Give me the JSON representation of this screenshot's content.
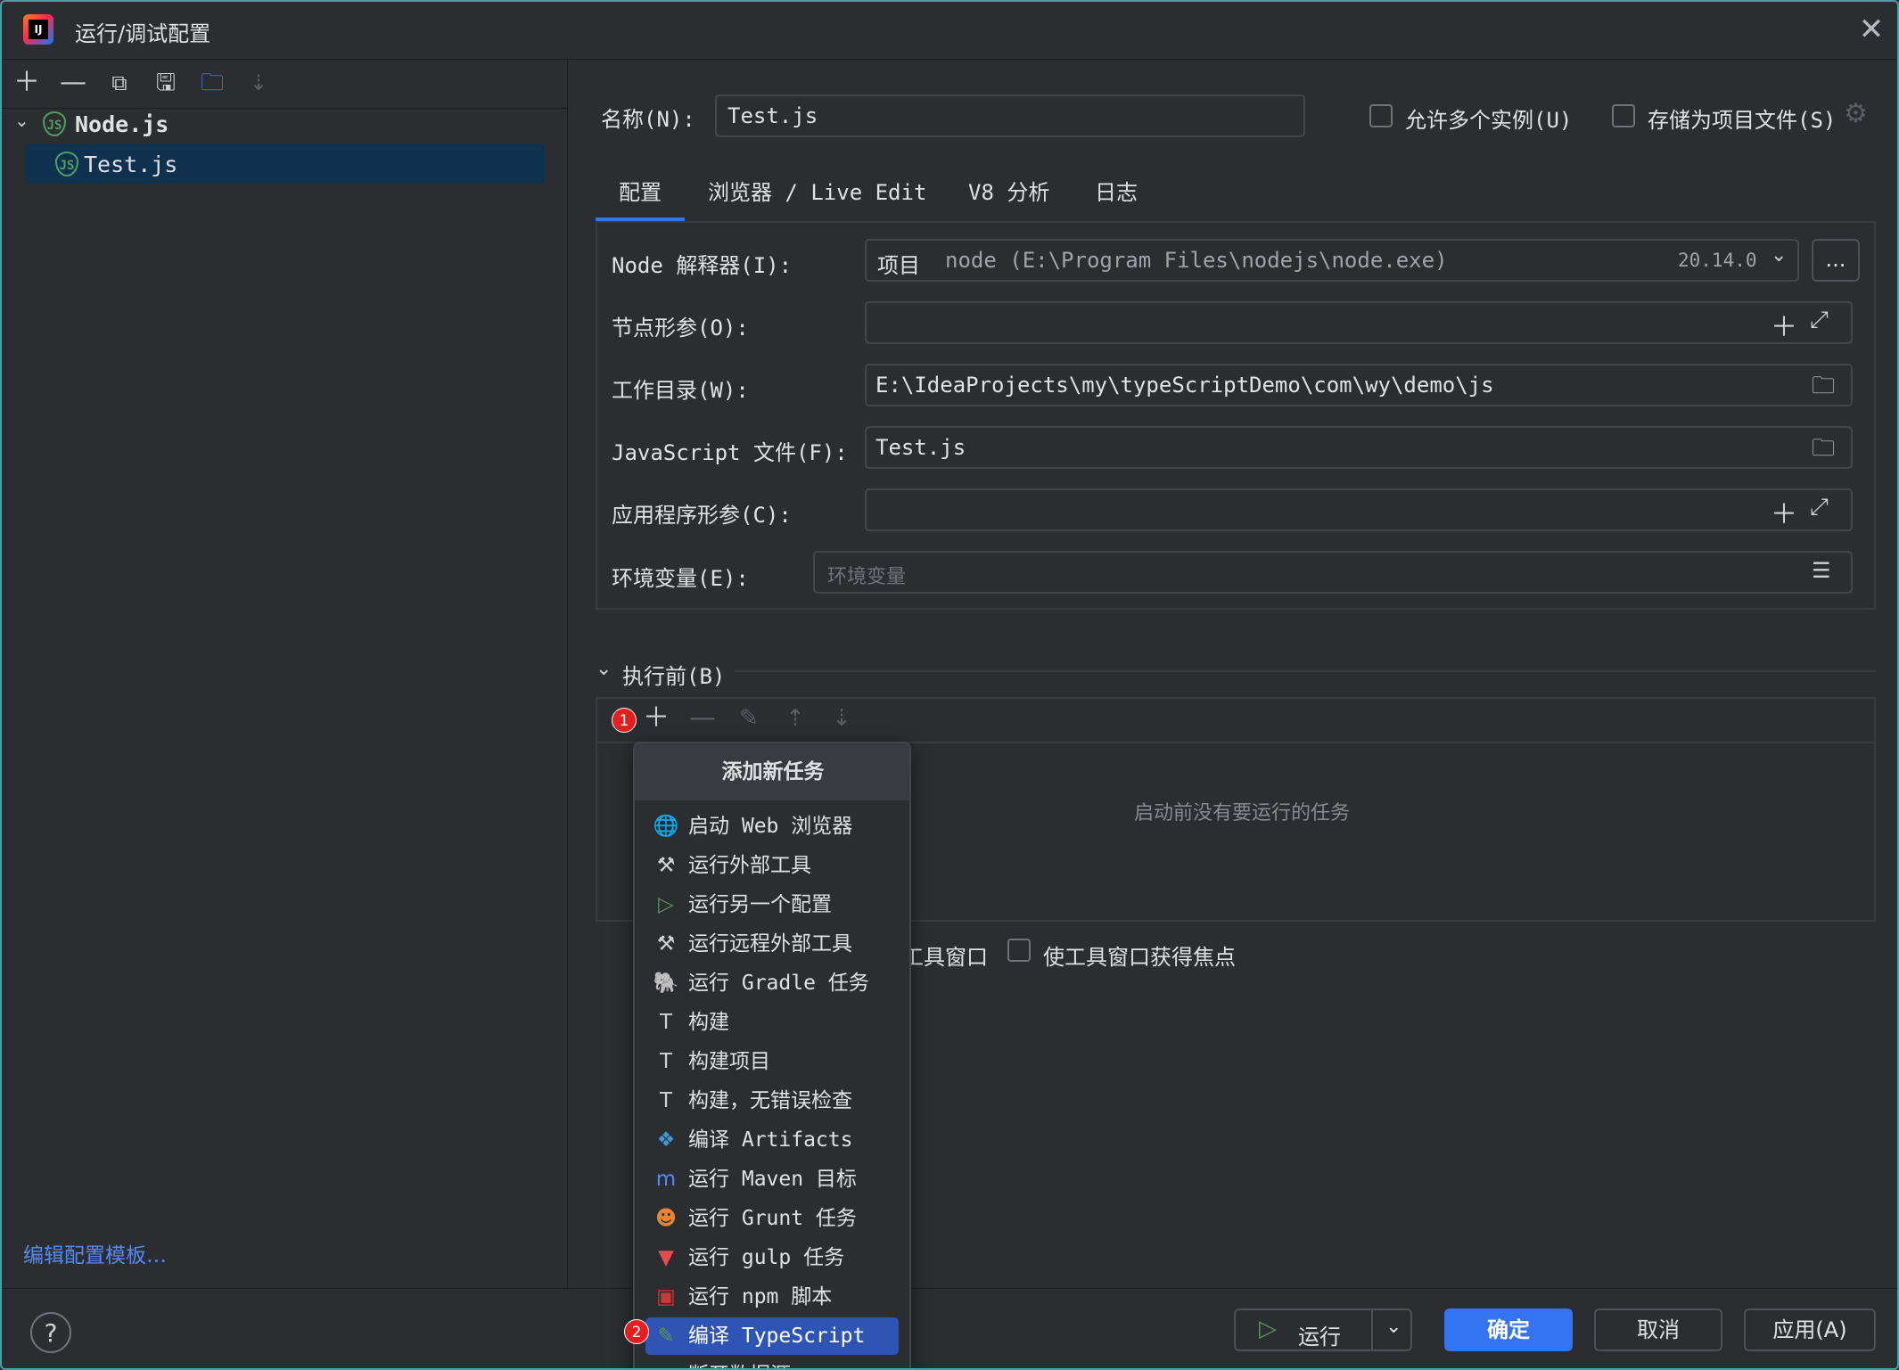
{
  "window": {
    "title": "运行/调试配置"
  },
  "sidebar": {
    "tree_root": "Node.js",
    "tree_child": "Test.js",
    "edit_templates_link": "编辑配置模板…"
  },
  "form": {
    "name_label": "名称(N):",
    "name_value": "Test.js",
    "allow_parallel_label": "允许多个实例(U)",
    "store_as_project_file_label": "存储为项目文件(S)",
    "tabs": [
      {
        "label": "配置",
        "active": true
      },
      {
        "label": "浏览器 / Live Edit"
      },
      {
        "label": "V8 分析"
      },
      {
        "label": "日志"
      }
    ],
    "node_interpreter_label": "Node 解释器(I):",
    "node_interpreter_prefix": "项目",
    "node_interpreter_value": "node (E:\\Program Files\\nodejs\\node.exe)",
    "node_interpreter_version": "20.14.0",
    "browse_button": "...",
    "node_params_label": "节点形参(O):",
    "working_dir_label": "工作目录(W):",
    "working_dir_value": "E:\\IdeaProjects\\my\\typeScriptDemo\\com\\wy\\demo\\js",
    "js_file_label": "JavaScript 文件(F):",
    "js_file_value": "Test.js",
    "app_params_label": "应用程序形参(C):",
    "env_label": "环境变量(E):",
    "env_placeholder": "环境变量"
  },
  "before_launch": {
    "header": "执行前(B)",
    "empty_text": "启动前没有要运行的任务",
    "show_window_partial": "工具窗口",
    "focus_window_label": "使工具窗口获得焦点",
    "badge1": "1",
    "badge2": "2"
  },
  "popup": {
    "title": "添加新任务",
    "items": [
      {
        "label": "启动 Web 浏览器",
        "icon": "globe-icon"
      },
      {
        "label": "运行外部工具",
        "icon": "tools-icon"
      },
      {
        "label": "运行另一个配置",
        "icon": "play-icon"
      },
      {
        "label": "运行远程外部工具",
        "icon": "tools-icon"
      },
      {
        "label": "运行 Gradle 任务",
        "icon": "gradle-icon"
      },
      {
        "label": "构建",
        "icon": "hammer-icon"
      },
      {
        "label": "构建项目",
        "icon": "hammer-icon"
      },
      {
        "label": "构建，无错误检查",
        "icon": "hammer-icon"
      },
      {
        "label": "编译 Artifacts",
        "icon": "artifacts-icon"
      },
      {
        "label": "运行 Maven 目标",
        "icon": "maven-icon"
      },
      {
        "label": "运行 Grunt 任务",
        "icon": "grunt-icon"
      },
      {
        "label": "运行 gulp 任务",
        "icon": "gulp-icon"
      },
      {
        "label": "运行 npm 脚本",
        "icon": "npm-icon"
      },
      {
        "label": "编译 TypeScript",
        "icon": "typescript-icon",
        "selected": true
      },
      {
        "label": "断开数据源",
        "icon": "datasource-icon"
      }
    ]
  },
  "footer": {
    "help": "?",
    "run": "运行",
    "ok": "确定",
    "cancel": "取消",
    "apply": "应用(A)"
  },
  "colors": {
    "accent": "#3574f0",
    "selection": "#0f3150",
    "badge": "#e51e1e",
    "node_green": "#4e9f63"
  }
}
